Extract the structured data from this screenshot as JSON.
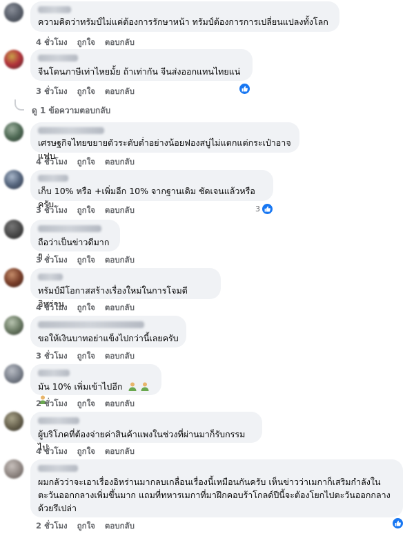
{
  "actions": {
    "like": "ถูกใจ",
    "reply": "ตอบกลับ"
  },
  "comments": [
    {
      "text": "ความคิดว่าทรัมป์ไม่แค่ต้องการรักษาหน้า ทรัมป์ต้องการการเปลี่ยนแปลงทั้งโลก",
      "time": "4 ชั่วโมง"
    },
    {
      "text": "จีนโดนภาษีเท่าไหยมั้ย ถ้าเท่ากัน จีนส่งออกแทนไทยแน่",
      "time": "3 ชั่วโมง"
    },
    {
      "text": "เศรษฐกิจไทยขยายตัวระดับต่ำอย่างน้อยฟองสบู่ไม่แตกแต่กระเป๋าอาจแฟบ",
      "time": "4 ชั่วโมง"
    },
    {
      "text": "เก็บ 10% หรือ +เพิ่มอีก 10% จากฐานเดิม ชัดเจนแล้วหรือครับ",
      "time": "3 ชั่วโมง",
      "reaction_count": "3"
    },
    {
      "text": "ถือว่าเป็นข่าวดีมาก ๆ",
      "time": "3 ชั่วโมง"
    },
    {
      "text": "ทรัมป์มีโอกาสสร้างเรื่องใหม่ในการโจมตี อิหร่าน",
      "time": "4 ชั่วโมง"
    },
    {
      "text": "ขอให้เงินบาทอย่าแข็งไปกว่านี้เลยครับ",
      "time": "3 ชั่วโมง"
    },
    {
      "text": "มัน 10% เพิ่มเข้าไปอีก",
      "time": "2 ชั่วโมง"
    },
    {
      "text": "ผู้บริโภคที่ต้องจ่ายค่าสินค้าแพงในช่วงที่ผ่านมาก็รับกรรมไป",
      "time": "4 ชั่วโมง"
    },
    {
      "text": "ผมกลัวว่าจะเอาเรื่องอิหร่านมากลบเกลื่อนเรื่องนี้เหมือนกันครับ เห็นข่าวว่าเมกาก็เสริมกำลังในตะวันออกกลางเพิ่มขึ้นมาก แถมที่ทหารเมกาที่มาฝึกคอบร้าโกลด์ปีนี้จะต้องโยกไปตะวันออกกลางด้วยรึเปล่า",
      "time": "2 ชั่วโมง"
    }
  ],
  "replies_link": "ดู 1 ข้อความตอบกลับ",
  "colors": {
    "bubble": "#f0f2f5",
    "meta": "#65676b",
    "like": "#1877f2"
  }
}
